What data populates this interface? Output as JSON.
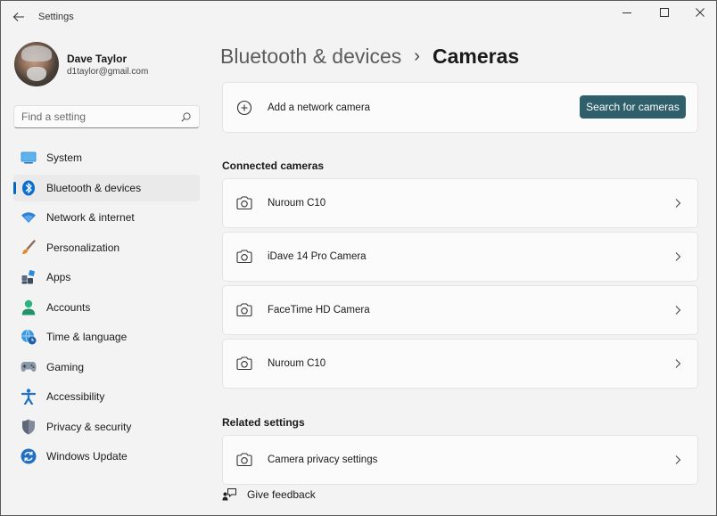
{
  "window": {
    "title": "Settings"
  },
  "profile": {
    "name": "Dave Taylor",
    "email": "d1taylor@gmail.com"
  },
  "search": {
    "placeholder": "Find a setting"
  },
  "sidebar": {
    "items": [
      {
        "label": "System",
        "icon": "system-icon"
      },
      {
        "label": "Bluetooth & devices",
        "icon": "bluetooth-icon",
        "active": true
      },
      {
        "label": "Network & internet",
        "icon": "wifi-icon"
      },
      {
        "label": "Personalization",
        "icon": "brush-icon"
      },
      {
        "label": "Apps",
        "icon": "apps-icon"
      },
      {
        "label": "Accounts",
        "icon": "person-icon"
      },
      {
        "label": "Time & language",
        "icon": "globe-clock-icon"
      },
      {
        "label": "Gaming",
        "icon": "gamepad-icon"
      },
      {
        "label": "Accessibility",
        "icon": "accessibility-icon"
      },
      {
        "label": "Privacy & security",
        "icon": "shield-icon"
      },
      {
        "label": "Windows Update",
        "icon": "update-icon"
      }
    ]
  },
  "breadcrumb": {
    "parent": "Bluetooth & devices",
    "separator": "›",
    "current": "Cameras"
  },
  "add_camera": {
    "label": "Add a network camera",
    "button": "Search for cameras"
  },
  "connected": {
    "title": "Connected cameras",
    "cameras": [
      {
        "name": "Nuroum C10"
      },
      {
        "name": "iDave 14 Pro Camera"
      },
      {
        "name": "FaceTime HD Camera"
      },
      {
        "name": "Nuroum C10"
      }
    ]
  },
  "related": {
    "title": "Related settings",
    "items": [
      {
        "label": "Camera privacy settings"
      }
    ]
  },
  "feedback": {
    "label": "Give feedback"
  },
  "colors": {
    "accent": "#0067c0",
    "button": "#2e5f6b",
    "background": "#f3f3f3",
    "card": "#fbfbfb"
  }
}
